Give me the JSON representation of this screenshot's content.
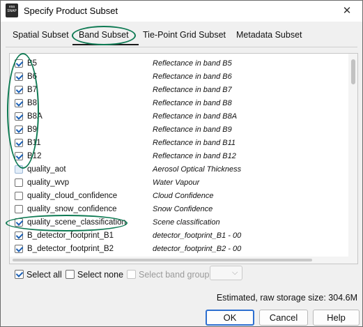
{
  "window": {
    "title": "Specify Product Subset",
    "close_glyph": "✕",
    "app_icon_text": "esa SNAP"
  },
  "tabs": [
    {
      "label": "Spatial Subset"
    },
    {
      "label": "Band Subset"
    },
    {
      "label": "Tie-Point Grid Subset"
    },
    {
      "label": "Metadata Subset"
    }
  ],
  "bands": [
    {
      "name": "B5",
      "desc": "Reflectance in band B5",
      "checked": true
    },
    {
      "name": "B6",
      "desc": "Reflectance in band B6",
      "checked": true
    },
    {
      "name": "B7",
      "desc": "Reflectance in band B7",
      "checked": true
    },
    {
      "name": "B8",
      "desc": "Reflectance in band B8",
      "checked": true
    },
    {
      "name": "B8A",
      "desc": "Reflectance in band B8A",
      "checked": true
    },
    {
      "name": "B9",
      "desc": "Reflectance in band B9",
      "checked": true
    },
    {
      "name": "B11",
      "desc": "Reflectance in band B11",
      "checked": true
    },
    {
      "name": "B12",
      "desc": "Reflectance in band B12",
      "checked": true
    },
    {
      "name": "quality_aot",
      "desc": "Aerosol Optical Thickness",
      "checked": false
    },
    {
      "name": "quality_wvp",
      "desc": "Water Vapour",
      "checked": false
    },
    {
      "name": "quality_cloud_confidence",
      "desc": "Cloud Confidence",
      "checked": false
    },
    {
      "name": "quality_snow_confidence",
      "desc": "Snow Confidence",
      "checked": false
    },
    {
      "name": "quality_scene_classification",
      "desc": "Scene classification",
      "checked": true
    },
    {
      "name": "B_detector_footprint_B1",
      "desc": "detector_footprint_B1 - 00",
      "checked": true
    },
    {
      "name": "B_detector_footprint_B2",
      "desc": "detector_footprint_B2 - 00",
      "checked": true
    }
  ],
  "controls": {
    "select_all": "Select all",
    "select_none": "Select none",
    "select_band_group": "Select band group"
  },
  "storage_text": "Estimated, raw storage size: 304.6M",
  "buttons": {
    "ok": "OK",
    "cancel": "Cancel",
    "help": "Help"
  },
  "colors": {
    "accent": "#2d6fd0",
    "annotation": "#0e7a53"
  }
}
